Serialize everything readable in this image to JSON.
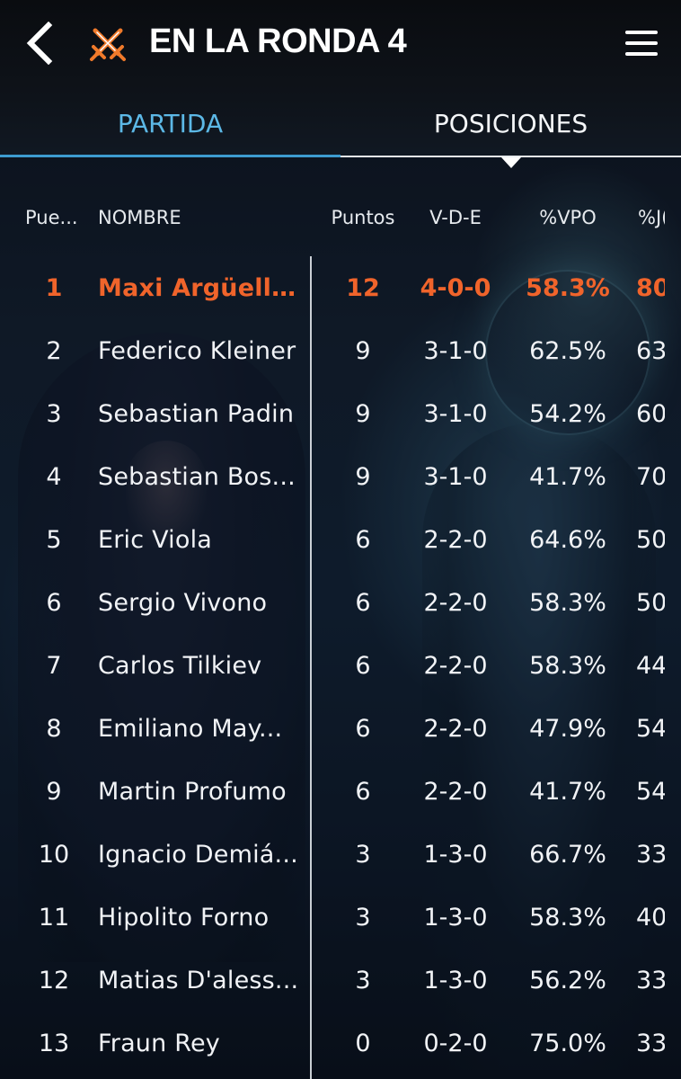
{
  "header": {
    "title": "EN LA RONDA 4",
    "back_icon": "chevron-left-icon",
    "app_icon": "crossed-swords-icon",
    "menu_icon": "hamburger-menu-icon"
  },
  "tabs": [
    {
      "label": "PARTIDA",
      "active": false
    },
    {
      "label": "POSICIONES",
      "active": true
    }
  ],
  "table": {
    "columns": {
      "pos": "Pue...",
      "name": "NOMBRE",
      "points": "Puntos",
      "record": "V-D-E",
      "vpo": "%VPO",
      "jg": "%J("
    },
    "rows": [
      {
        "pos": "1",
        "name": "Maxi Argüello...",
        "points": "12",
        "record": "4-0-0",
        "vpo": "58.3%",
        "jg": "80",
        "highlight": true
      },
      {
        "pos": "2",
        "name": "Federico  Kleiner",
        "points": "9",
        "record": "3-1-0",
        "vpo": "62.5%",
        "jg": "63"
      },
      {
        "pos": "3",
        "name": "Sebastian  Padin",
        "points": "9",
        "record": "3-1-0",
        "vpo": "54.2%",
        "jg": "60"
      },
      {
        "pos": "4",
        "name": "Sebastian  Bos...",
        "points": "9",
        "record": "3-1-0",
        "vpo": "41.7%",
        "jg": "70"
      },
      {
        "pos": "5",
        "name": "Eric Viola",
        "points": "6",
        "record": "2-2-0",
        "vpo": "64.6%",
        "jg": "50"
      },
      {
        "pos": "6",
        "name": "Sergio Vivono",
        "points": "6",
        "record": "2-2-0",
        "vpo": "58.3%",
        "jg": "50"
      },
      {
        "pos": "7",
        "name": "Carlos Tilkiev",
        "points": "6",
        "record": "2-2-0",
        "vpo": "58.3%",
        "jg": "44"
      },
      {
        "pos": "8",
        "name": "Emiliano  May...",
        "points": "6",
        "record": "2-2-0",
        "vpo": "47.9%",
        "jg": "54"
      },
      {
        "pos": "9",
        "name": "Martin Profumo",
        "points": "6",
        "record": "2-2-0",
        "vpo": "41.7%",
        "jg": "54"
      },
      {
        "pos": "10",
        "name": "Ignacio Demiá...",
        "points": "3",
        "record": "1-3-0",
        "vpo": "66.7%",
        "jg": "33"
      },
      {
        "pos": "11",
        "name": "Hipolito Forno",
        "points": "3",
        "record": "1-3-0",
        "vpo": "58.3%",
        "jg": "40"
      },
      {
        "pos": "12",
        "name": "Matias D'aless...",
        "points": "3",
        "record": "1-3-0",
        "vpo": "56.2%",
        "jg": "33"
      },
      {
        "pos": "13",
        "name": "Fraun Rey",
        "points": "0",
        "record": "0-2-0",
        "vpo": "75.0%",
        "jg": "33"
      }
    ]
  },
  "colors": {
    "highlight": "#f0642b",
    "active_tab_text": "#5cb8e6",
    "active_tab_underline": "#3d9bd0",
    "text": "#f1f3f6"
  }
}
